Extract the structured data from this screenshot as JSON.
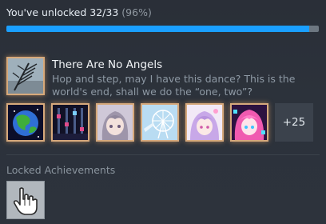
{
  "progress": {
    "label": "You've unlocked 32/33",
    "percent_label": "(96%)",
    "fraction": 0.97
  },
  "featured": {
    "title": "There Are No Angels",
    "description": "Hop and step, may I have this dance? This is the world's end, shall we do the “one, two”?",
    "icon": "tv-antenna-icon"
  },
  "recent_icons": [
    "earth-icon",
    "pixel-stage-icon",
    "anime-girl-gray-hair-icon",
    "ferris-wheel-icon",
    "anime-girl-lavender-hair-icon",
    "anime-girl-pink-hair-icon"
  ],
  "more_count": "+25",
  "locked": {
    "heading": "Locked Achievements",
    "icon": "pointing-hand-cursor-icon"
  },
  "colors": {
    "progress_fill": "#1a9fff",
    "progress_track": "#6d7781",
    "unlocked_border": "#d6a97c"
  }
}
